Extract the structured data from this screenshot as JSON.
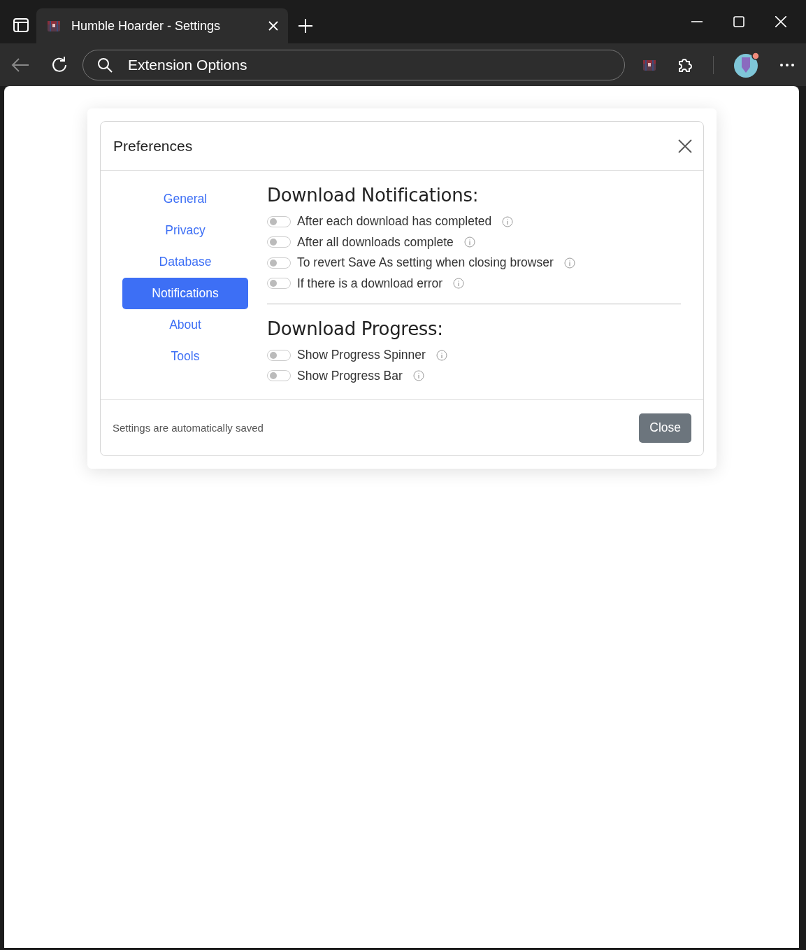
{
  "browser": {
    "tab_title": "Humble Hoarder - Settings",
    "address": "Extension Options"
  },
  "dialog": {
    "title": "Preferences",
    "nav": [
      {
        "label": "General",
        "selected": false
      },
      {
        "label": "Privacy",
        "selected": false
      },
      {
        "label": "Database",
        "selected": false
      },
      {
        "label": "Notifications",
        "selected": true
      },
      {
        "label": "About",
        "selected": false
      },
      {
        "label": "Tools",
        "selected": false
      }
    ],
    "sections": [
      {
        "heading": "Download Notifications:",
        "options": [
          {
            "label": "After each download has completed",
            "on": false
          },
          {
            "label": "After all downloads complete",
            "on": false
          },
          {
            "label": "To revert Save As setting when closing browser",
            "on": false
          },
          {
            "label": "If there is a download error",
            "on": false
          }
        ]
      },
      {
        "heading": "Download Progress:",
        "options": [
          {
            "label": "Show Progress Spinner",
            "on": false
          },
          {
            "label": "Show Progress Bar",
            "on": false
          }
        ]
      }
    ],
    "footer_note": "Settings are automatically saved",
    "close_button": "Close"
  }
}
